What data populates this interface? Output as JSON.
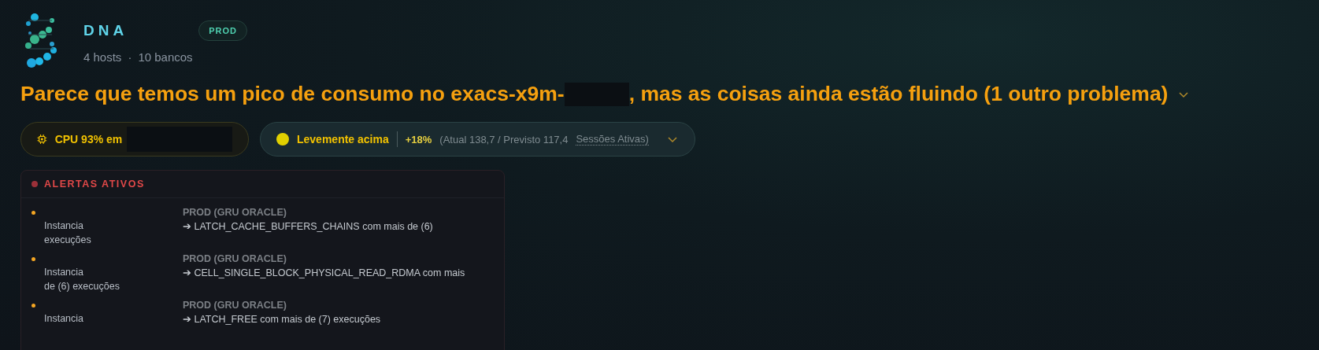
{
  "header": {
    "title": "DNA",
    "env_badge": "PROD",
    "hosts": "4 hosts",
    "separator": "·",
    "databases": "10 bancos"
  },
  "headline": {
    "before": "Parece que temos um pico de consumo no exacs-x9m-",
    "after": ", mas as coisas ainda estão fluindo (1 outro problema)",
    "expanded": false
  },
  "pills": [
    {
      "kind": "cpu",
      "label": "CPU 93% em"
    },
    {
      "kind": "trend",
      "label": "Levemente acima",
      "delta": "+18%",
      "detail": "(Atual 138,7 / Previsto 117,4",
      "metric": "Sessões Ativas)",
      "expanded": false
    }
  ],
  "alerts_panel": {
    "title": "ALERTAS ATIVOS",
    "alerts": [
      {
        "instance": "Instancia",
        "tail": "execuções",
        "source": "PROD (GRU ORACLE)",
        "message": "➔ LATCH_CACHE_BUFFERS_CHAINS com mais de (6)",
        "color": "#f5a623"
      },
      {
        "instance": "Instancia",
        "tail": "de (6) execuções",
        "source": "PROD (GRU ORACLE)",
        "message": "➔ CELL_SINGLE_BLOCK_PHYSICAL_READ_RDMA com mais",
        "color": "#f5a623"
      },
      {
        "instance": "Instancia",
        "source": "PROD (GRU ORACLE)",
        "message": "➔ LATCH_FREE com mais de (7) execuções",
        "color": "#f5a623"
      }
    ]
  }
}
